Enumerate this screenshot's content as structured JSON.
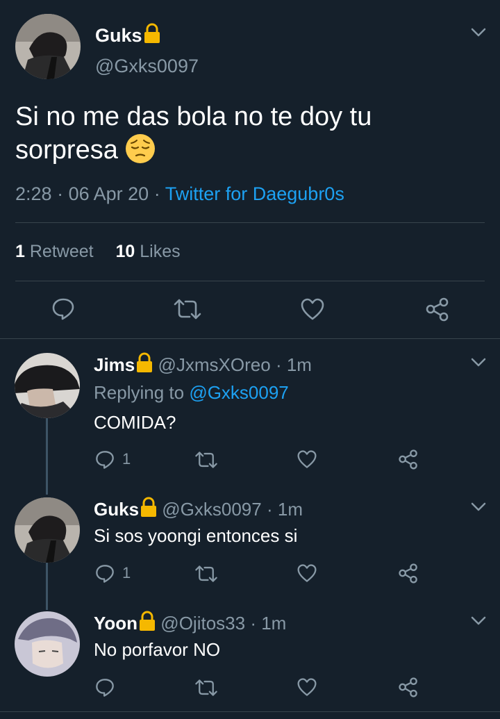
{
  "main_tweet": {
    "display_name": "Guks",
    "handle": "@Gxks0097",
    "text_line1": "Si no me das bola no te doy tu",
    "text_line2": "sorpresa",
    "time": "2:28",
    "date": "06 Apr 20",
    "source": "Twitter for Daegubr0s",
    "retweets_count": "1",
    "retweets_label": "Retweet",
    "likes_count": "10",
    "likes_label": "Likes"
  },
  "replies": [
    {
      "display_name": "Jims",
      "handle": "@JxmsXOreo",
      "time": "1m",
      "replying_prefix": "Replying to",
      "replying_to": "@Gxks0097",
      "text": "COMIDA?",
      "reply_count": "1"
    },
    {
      "display_name": "Guks",
      "handle": "@Gxks0097",
      "time": "1m",
      "text": "Si sos yoongi entonces si",
      "reply_count": "1"
    },
    {
      "display_name": "Yoon",
      "handle": "@Ojitos33",
      "time": "1m",
      "text": "No porfavor NO"
    }
  ],
  "colors": {
    "background": "#15202b",
    "accent": "#1da1f2",
    "muted": "#8899a6",
    "divider": "#38444d",
    "lock": "#f5b800"
  }
}
